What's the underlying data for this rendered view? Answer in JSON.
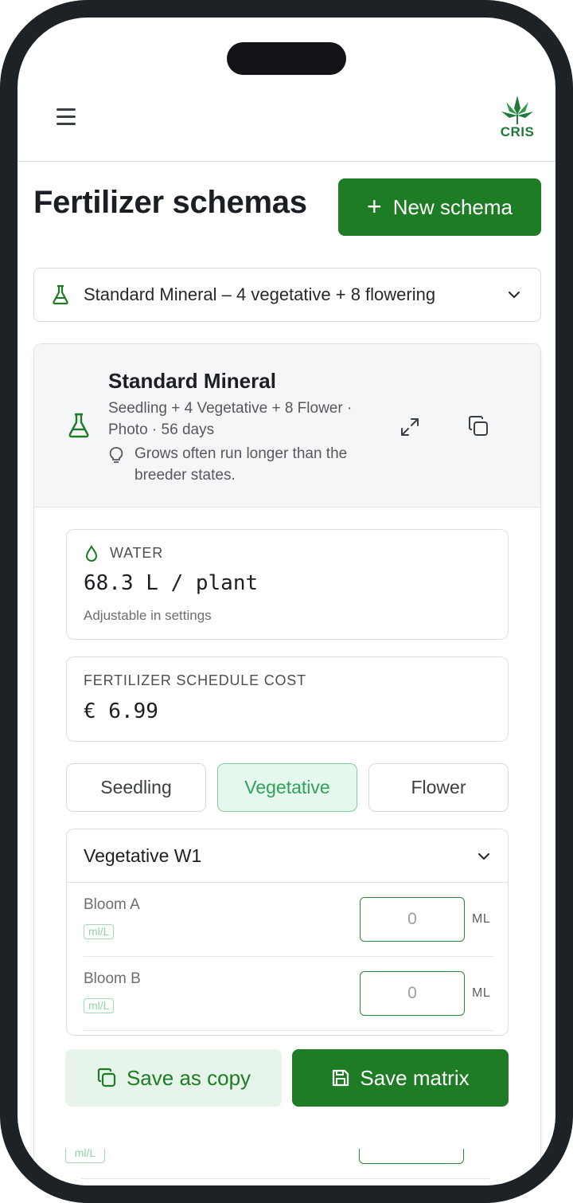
{
  "app": {
    "logo_text": "CRIS"
  },
  "page": {
    "title": "Fertilizer schemas",
    "new_button_label": "New schema"
  },
  "schema_select": {
    "selected": "Standard Mineral – 4 vegetative + 8 flowering"
  },
  "schema": {
    "name": "Standard Mineral",
    "subtitle": "Seedling + 4 Vegetative + 8 Flower · Photo · 56 days",
    "tip": "Grows often run longer than the breeder states."
  },
  "water": {
    "label": "WATER",
    "value": "68.3 L / plant",
    "note": "Adjustable in settings"
  },
  "cost": {
    "label": "FERTILIZER SCHEDULE COST",
    "value": "€ 6.99"
  },
  "phases": [
    {
      "label": "Seedling",
      "active": false
    },
    {
      "label": "Vegetative",
      "active": true
    },
    {
      "label": "Flower",
      "active": false
    }
  ],
  "week": {
    "title": "Vegetative W1",
    "rows": [
      {
        "name": "Bloom A",
        "unit_badge": "ml/L",
        "value": "0",
        "unit": "ML"
      },
      {
        "name": "Bloom B",
        "unit_badge": "ml/L",
        "value": "0",
        "unit": "ML"
      }
    ],
    "partial_row_badge": "ml/L"
  },
  "actions": {
    "save_copy_label": "Save as copy",
    "save_matrix_label": "Save matrix"
  },
  "colors": {
    "brand": "#1d7c24",
    "accent_light": "#e6f7ed",
    "accent_text": "#2fa25a"
  }
}
